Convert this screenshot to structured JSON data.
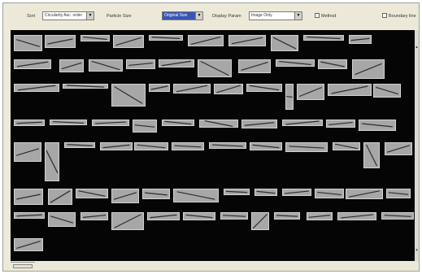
{
  "toolbar": {
    "sort_label": "Sort",
    "sort_value": "Circularity Asc. order",
    "particle_size_label": "Particle Size",
    "particle_size_value": "Original Size",
    "display_param_label": "Display Param",
    "display_param_value": "Image Only",
    "method_label": "Method",
    "boundary_label": "Boundary line"
  },
  "colors": {
    "gallery_background": "#050505",
    "tile_background": "#a7a7a7",
    "particle_stroke": "#2c2c2c",
    "selected_dropdown": "#3a55b4"
  },
  "icons": {
    "dropdown": "chevron-down-icon",
    "scroll_up": "arrow-up-icon",
    "scroll_down": "arrow-down-icon"
  },
  "gallery": {
    "particle_count": 112
  }
}
